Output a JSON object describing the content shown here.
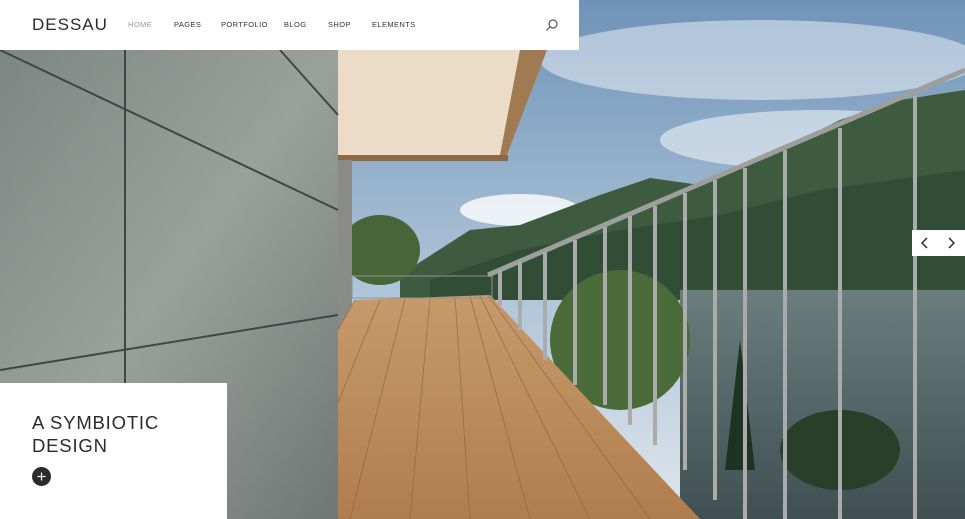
{
  "header": {
    "logo": "DESSAU",
    "nav": [
      {
        "label": "HOME",
        "active": true
      },
      {
        "label": "PAGES",
        "active": false
      },
      {
        "label": "PORTFOLIO",
        "active": false
      },
      {
        "label": "BLOG",
        "active": false
      },
      {
        "label": "SHOP",
        "active": false
      },
      {
        "label": "ELEMENTS",
        "active": false
      }
    ],
    "search_icon": "search-icon"
  },
  "slider": {
    "prev_icon": "chevron-left-icon",
    "next_icon": "chevron-right-icon"
  },
  "caption": {
    "line1": "A SYMBIOTIC",
    "line2": "DESIGN",
    "button_icon": "plus-icon"
  },
  "colors": {
    "dark": "#2b2b2b",
    "nav_active": "#9a9a9a",
    "white": "#ffffff"
  }
}
